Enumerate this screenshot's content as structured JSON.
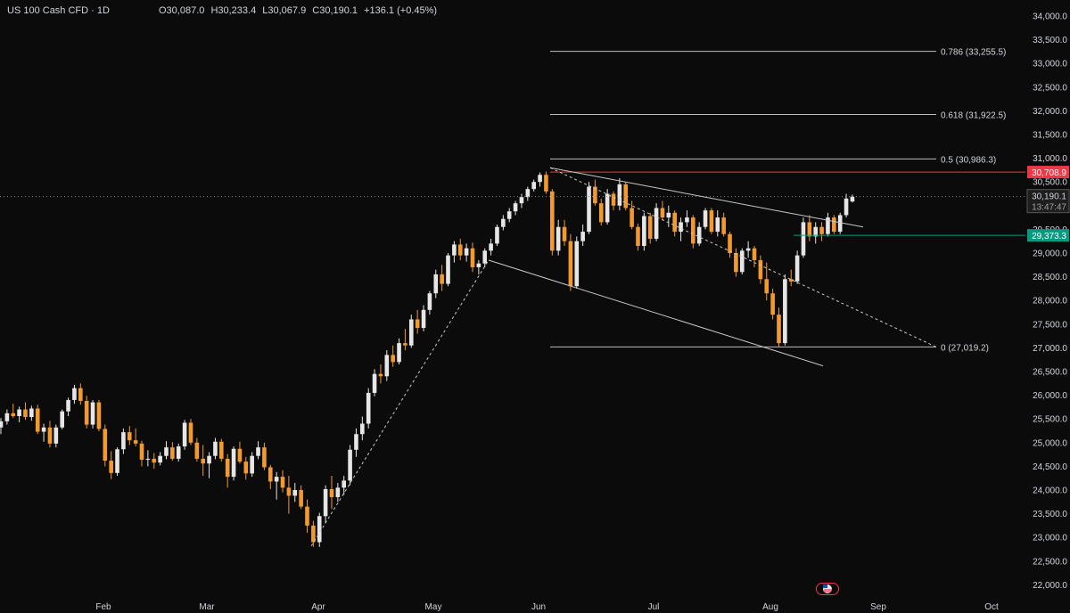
{
  "header": {
    "symbol": "US 100 Cash CFD · 1D",
    "open": "O30,087.0",
    "high": "H30,233.4",
    "low": "L30,067.9",
    "close": "C30,190.1",
    "change": "+136.1 (+0.45%)"
  },
  "colors": {
    "background": "#0b0b0b",
    "up_candle": "#e6e6e6",
    "down_candle": "#f29a2e",
    "resistance_badge": "#f23645",
    "support_badge": "#089981",
    "fib_line": "#bdbdbd"
  },
  "price_badges": {
    "resistance": "30,708.9",
    "current": "30,190.1",
    "countdown": "13:47:47",
    "support": "29,373.3"
  },
  "chart_data": {
    "type": "candlestick",
    "symbol": "US 100 Cash CFD",
    "timeframe": "1D",
    "ylim": [
      21900,
      34050
    ],
    "y_ticks": [
      "34,000.0",
      "33,500.0",
      "33,000.0",
      "32,500.0",
      "32,000.0",
      "31,500.0",
      "31,000.0",
      "30,500.0",
      "29,500.0",
      "29,000.0",
      "28,500.0",
      "28,000.0",
      "27,500.0",
      "27,000.0",
      "26,500.0",
      "26,000.0",
      "25,500.0",
      "25,000.0",
      "24,500.0",
      "24,000.0",
      "23,500.0",
      "23,000.0",
      "22,500.0",
      "22,000.0"
    ],
    "x_ticks": [
      "Feb",
      "Mar",
      "Apr",
      "May",
      "Jun",
      "Jul",
      "Aug",
      "Sep",
      "Oct"
    ],
    "fibonacci": [
      {
        "label": "0.786 (33,255.5)",
        "value": 33255.5
      },
      {
        "label": "0.618 (31,922.5)",
        "value": 31922.5
      },
      {
        "label": "0.5 (30,986.3)",
        "value": 30986.3
      },
      {
        "label": "0 (27,019.2)",
        "value": 27019.2
      }
    ],
    "horizontal_levels": [
      {
        "name": "resistance",
        "value": 30708.9
      },
      {
        "name": "support",
        "value": 29373.3
      }
    ],
    "last_price": 30190.1,
    "candles": [
      [
        25320,
        25520,
        25180,
        25450
      ],
      [
        25450,
        25700,
        25380,
        25620
      ],
      [
        25620,
        25820,
        25520,
        25560
      ],
      [
        25560,
        25760,
        25430,
        25700
      ],
      [
        25700,
        25850,
        25480,
        25540
      ],
      [
        25540,
        25780,
        25460,
        25720
      ],
      [
        25720,
        25800,
        25180,
        25230
      ],
      [
        25230,
        25400,
        25020,
        25320
      ],
      [
        25320,
        25460,
        24900,
        24980
      ],
      [
        24980,
        25380,
        24900,
        25320
      ],
      [
        25320,
        25700,
        25280,
        25660
      ],
      [
        25660,
        25950,
        25560,
        25900
      ],
      [
        25900,
        26220,
        25820,
        26150
      ],
      [
        26150,
        26250,
        25800,
        25880
      ],
      [
        25880,
        25990,
        25300,
        25380
      ],
      [
        25380,
        25900,
        25300,
        25850
      ],
      [
        25850,
        25900,
        25240,
        25290
      ],
      [
        25290,
        25380,
        24500,
        24620
      ],
      [
        24620,
        24820,
        24230,
        24360
      ],
      [
        24360,
        24900,
        24300,
        24860
      ],
      [
        24860,
        25300,
        24760,
        25220
      ],
      [
        25220,
        25350,
        24950,
        25050
      ],
      [
        25050,
        25300,
        24920,
        24980
      ],
      [
        24980,
        25040,
        24500,
        24640
      ],
      [
        24640,
        24840,
        24500,
        24660
      ],
      [
        24660,
        24780,
        24450,
        24580
      ],
      [
        24580,
        24800,
        24520,
        24720
      ],
      [
        24720,
        25030,
        24650,
        24900
      ],
      [
        24900,
        25010,
        24620,
        24660
      ],
      [
        24660,
        24980,
        24600,
        24920
      ],
      [
        24920,
        25480,
        24850,
        25420
      ],
      [
        25420,
        25500,
        24950,
        25000
      ],
      [
        25000,
        25100,
        24600,
        24660
      ],
      [
        24660,
        24950,
        24300,
        24560
      ],
      [
        24560,
        24800,
        24250,
        24720
      ],
      [
        24720,
        25100,
        24650,
        25020
      ],
      [
        25020,
        25080,
        24600,
        24660
      ],
      [
        24660,
        24760,
        24050,
        24280
      ],
      [
        24280,
        24920,
        24200,
        24870
      ],
      [
        24870,
        25020,
        24560,
        24600
      ],
      [
        24600,
        24700,
        24220,
        24350
      ],
      [
        24350,
        24800,
        24280,
        24720
      ],
      [
        24720,
        25030,
        24650,
        24900
      ],
      [
        24900,
        25000,
        24420,
        24480
      ],
      [
        24480,
        24530,
        24020,
        24180
      ],
      [
        24180,
        24380,
        23800,
        24280
      ],
      [
        24280,
        24420,
        23950,
        24050
      ],
      [
        24050,
        24300,
        23500,
        23880
      ],
      [
        23880,
        24150,
        23750,
        24000
      ],
      [
        24000,
        24100,
        23600,
        23650
      ],
      [
        23650,
        23800,
        23100,
        23250
      ],
      [
        23250,
        23350,
        22800,
        22900
      ],
      [
        22900,
        23520,
        22800,
        23450
      ],
      [
        23450,
        24100,
        23300,
        24020
      ],
      [
        24020,
        24300,
        23600,
        23850
      ],
      [
        23850,
        24150,
        23750,
        24050
      ],
      [
        24050,
        24300,
        23900,
        24200
      ],
      [
        24200,
        24950,
        24100,
        24850
      ],
      [
        24850,
        25300,
        24700,
        25180
      ],
      [
        25180,
        25550,
        25050,
        25400
      ],
      [
        25400,
        26150,
        25300,
        26050
      ],
      [
        26050,
        26550,
        25980,
        26450
      ],
      [
        26450,
        26650,
        26250,
        26400
      ],
      [
        26400,
        26950,
        26300,
        26850
      ],
      [
        26850,
        27050,
        26600,
        26700
      ],
      [
        26700,
        27200,
        26650,
        27100
      ],
      [
        27100,
        27400,
        26950,
        27050
      ],
      [
        27050,
        27700,
        27000,
        27600
      ],
      [
        27600,
        27800,
        27300,
        27420
      ],
      [
        27420,
        27900,
        27350,
        27800
      ],
      [
        27800,
        28200,
        27700,
        28150
      ],
      [
        28150,
        28650,
        28050,
        28550
      ],
      [
        28550,
        28750,
        28200,
        28350
      ],
      [
        28350,
        29000,
        28300,
        28950
      ],
      [
        28950,
        29250,
        28800,
        29180
      ],
      [
        29180,
        29300,
        28850,
        28950
      ],
      [
        28950,
        29200,
        28820,
        29100
      ],
      [
        29100,
        29220,
        28600,
        28700
      ],
      [
        28700,
        28850,
        28550,
        28780
      ],
      [
        28780,
        29100,
        28700,
        29050
      ],
      [
        29050,
        29300,
        28950,
        29200
      ],
      [
        29200,
        29600,
        29150,
        29550
      ],
      [
        29550,
        29800,
        29480,
        29720
      ],
      [
        29720,
        29950,
        29650,
        29880
      ],
      [
        29880,
        30100,
        29800,
        30050
      ],
      [
        30050,
        30250,
        29950,
        30180
      ],
      [
        30180,
        30400,
        30100,
        30350
      ],
      [
        30350,
        30550,
        30300,
        30500
      ],
      [
        30500,
        30700,
        30400,
        30650
      ],
      [
        30650,
        30720,
        30250,
        30300
      ],
      [
        30300,
        30350,
        28950,
        29050
      ],
      [
        29050,
        29700,
        28950,
        29550
      ],
      [
        29550,
        29700,
        29150,
        29250
      ],
      [
        29250,
        29400,
        28200,
        28300
      ],
      [
        28300,
        29350,
        28250,
        29250
      ],
      [
        29250,
        29600,
        29150,
        29450
      ],
      [
        29450,
        30500,
        29400,
        30400
      ],
      [
        30400,
        30550,
        30000,
        30050
      ],
      [
        30050,
        30150,
        29580,
        29650
      ],
      [
        29650,
        30350,
        29600,
        30250
      ],
      [
        30250,
        30300,
        29900,
        30000
      ],
      [
        30000,
        30580,
        29900,
        30450
      ],
      [
        30450,
        30500,
        29900,
        29950
      ],
      [
        29950,
        30100,
        29500,
        29550
      ],
      [
        29550,
        29620,
        29050,
        29150
      ],
      [
        29150,
        29850,
        29050,
        29780
      ],
      [
        29780,
        29850,
        29200,
        29300
      ],
      [
        29300,
        30050,
        29250,
        29950
      ],
      [
        29950,
        30100,
        29700,
        29750
      ],
      [
        29750,
        30000,
        29550,
        29850
      ],
      [
        29850,
        29900,
        29350,
        29450
      ],
      [
        29450,
        29750,
        29250,
        29650
      ],
      [
        29650,
        29900,
        29550,
        29750
      ],
      [
        29750,
        29800,
        29100,
        29200
      ],
      [
        29200,
        29650,
        29150,
        29550
      ],
      [
        29550,
        29950,
        29500,
        29900
      ],
      [
        29900,
        29950,
        29400,
        29450
      ],
      [
        29450,
        29900,
        29350,
        29750
      ],
      [
        29750,
        29850,
        29350,
        29400
      ],
      [
        29400,
        29450,
        28900,
        29000
      ],
      [
        29000,
        29100,
        28500,
        28600
      ],
      [
        28600,
        29100,
        28550,
        29050
      ],
      [
        29050,
        29250,
        28900,
        29100
      ],
      [
        29100,
        29150,
        28700,
        28850
      ],
      [
        28850,
        28950,
        28350,
        28450
      ],
      [
        28450,
        28800,
        28000,
        28150
      ],
      [
        28150,
        28250,
        27600,
        27700
      ],
      [
        27700,
        27850,
        27020,
        27100
      ],
      [
        27100,
        28550,
        27050,
        28450
      ],
      [
        28450,
        28650,
        28300,
        28400
      ],
      [
        28400,
        29050,
        28350,
        28950
      ],
      [
        28950,
        29750,
        28900,
        29650
      ],
      [
        29650,
        29800,
        29250,
        29350
      ],
      [
        29350,
        29650,
        29200,
        29550
      ],
      [
        29550,
        29650,
        29250,
        29400
      ],
      [
        29400,
        29850,
        29350,
        29750
      ],
      [
        29750,
        29800,
        29400,
        29450
      ],
      [
        29450,
        29850,
        29400,
        29800
      ],
      [
        29800,
        30250,
        29750,
        30150
      ],
      [
        30087,
        30233.4,
        30067.9,
        30190.1
      ]
    ]
  }
}
